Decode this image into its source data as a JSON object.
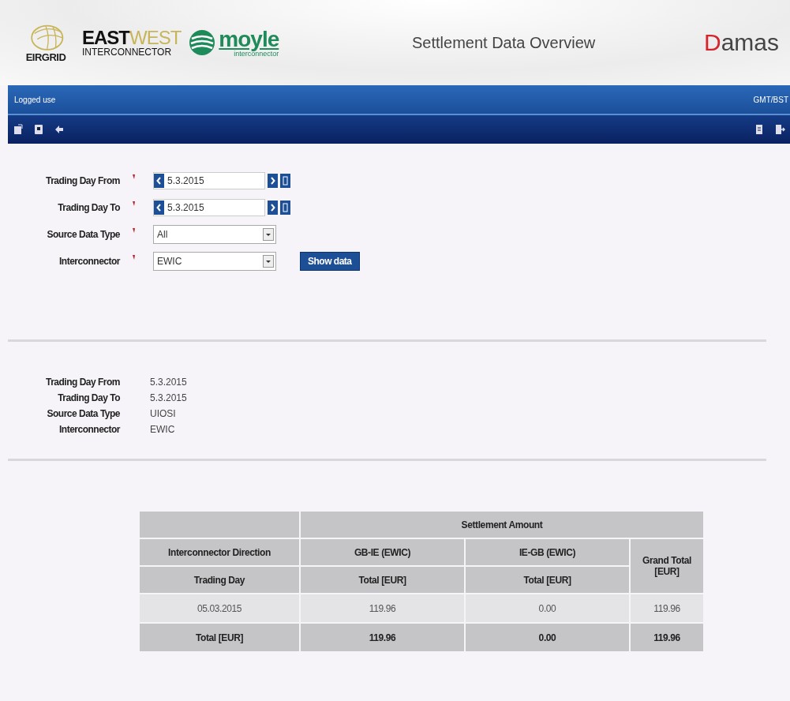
{
  "header": {
    "eirgrid_logo": "EIRGRID",
    "eastwest_logo": {
      "east": "EAST",
      "west": "WEST",
      "sub": "INTERCONNECTOR"
    },
    "moyle_logo": {
      "name": "moyle",
      "sub": "interconnector"
    },
    "title": "Settlement Data Overview",
    "damas_logo": "Damas"
  },
  "user_bar": {
    "user": "Logged use",
    "timezone": "GMT/BST"
  },
  "form": {
    "fields": [
      {
        "label": "Trading Day From",
        "required": true,
        "kind": "date",
        "value": "5.3.2015"
      },
      {
        "label": "Trading Day To",
        "required": true,
        "kind": "date",
        "value": "5.3.2015"
      },
      {
        "label": "Source Data Type",
        "required": true,
        "kind": "select",
        "value": "All"
      },
      {
        "label": "Interconnector",
        "required": true,
        "kind": "select",
        "value": "EWIC"
      }
    ],
    "button": "Show data"
  },
  "summary": [
    {
      "label": "Trading Day From",
      "value": "5.3.2015"
    },
    {
      "label": "Trading Day To",
      "value": "5.3.2015"
    },
    {
      "label": "Source Data Type",
      "value": "UIOSI"
    },
    {
      "label": "Interconnector",
      "value": "EWIC"
    }
  ],
  "table": {
    "group_header": "Settlement Amount",
    "direction_header": "Interconnector Direction",
    "directions": [
      "GB-IE (EWIC)",
      "IE-GB (EWIC)"
    ],
    "grand_total_header": "Grand Total [EUR]",
    "day_header": "Trading Day",
    "sub_headers": [
      "Total [EUR]",
      "Total [EUR]"
    ],
    "rows": [
      {
        "kind": "data",
        "cells": [
          "05.03.2015",
          "119.96",
          "0.00",
          "119.96"
        ]
      },
      {
        "kind": "total",
        "cells": [
          "Total [EUR]",
          "119.96",
          "0.00",
          "119.96"
        ]
      }
    ]
  }
}
